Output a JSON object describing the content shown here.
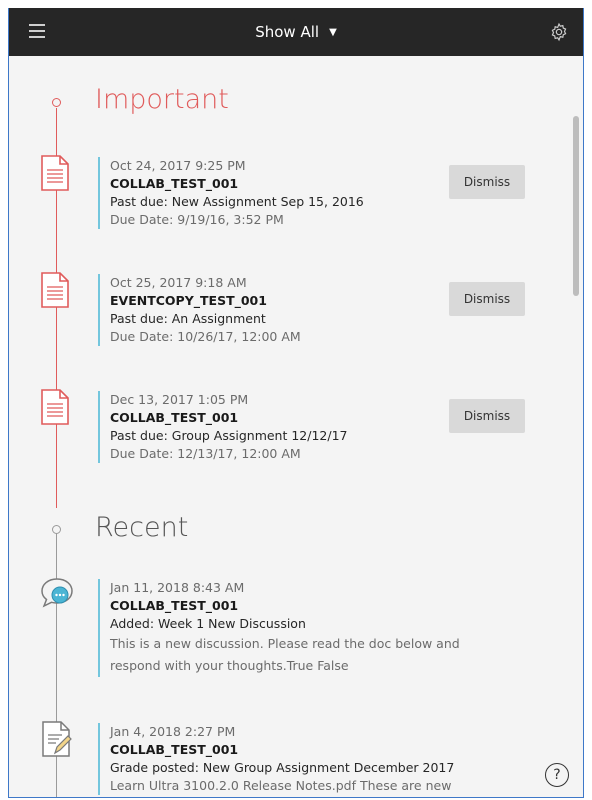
{
  "header": {
    "filter_label": "Show All",
    "filter_caret": "▼"
  },
  "sections": {
    "important": {
      "title": "Important",
      "color": "#e05b5b",
      "dismiss_label": "Dismiss",
      "items": [
        {
          "date": "Oct 24, 2017 9:25 PM",
          "course": "COLLAB_TEST_001",
          "title": "Past due: New Assignment Sep 15, 2016",
          "detail": "Due Date: 9/19/16, 3:52 PM"
        },
        {
          "date": "Oct 25, 2017 9:18 AM",
          "course": "EVENTCOPY_TEST_001",
          "title": "Past due: An Assignment",
          "detail": "Due Date: 10/26/17, 12:00 AM"
        },
        {
          "date": "Dec 13, 2017 1:05 PM",
          "course": "COLLAB_TEST_001",
          "title": "Past due: Group Assignment 12/12/17",
          "detail": "Due Date: 12/13/17, 12:00 AM"
        }
      ]
    },
    "recent": {
      "title": "Recent",
      "color": "#9a9a9a",
      "items": [
        {
          "date": "Jan 11, 2018 8:43 AM",
          "course": "COLLAB_TEST_001",
          "title": "Added: Week 1 New Discussion",
          "detail": "This is a new discussion. Please read the doc below and respond with your thoughts.True False"
        },
        {
          "date": "Jan 4, 2018 2:27 PM",
          "course": "COLLAB_TEST_001",
          "title": "Grade posted: New Group Assignment December 2017",
          "detail": "Learn Ultra 3100.2.0 Release Notes.pdf These are new"
        }
      ]
    }
  },
  "help": {
    "label": "?"
  },
  "colors": {
    "header_bg": "#262626",
    "accent_line": "#73c6dd",
    "important": "#e05b5b",
    "recent": "#9a9a9a",
    "discussion_icon": "#4bb5d4"
  },
  "icons": {
    "menu": "hamburger-menu-icon",
    "settings": "gear-icon",
    "assignment": "document-icon",
    "discussion": "chat-bubble-icon",
    "grade": "document-pencil-icon",
    "help": "help-icon"
  }
}
